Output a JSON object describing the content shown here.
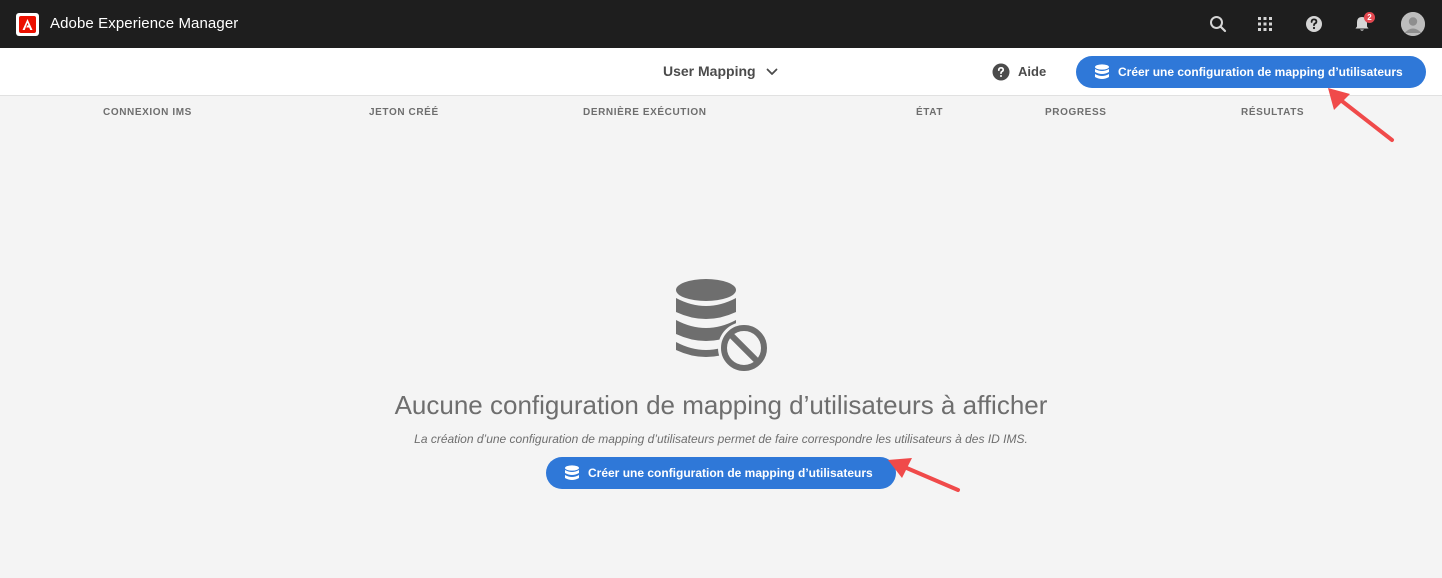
{
  "header": {
    "app_title": "Adobe Experience Manager",
    "icons": [
      "search-icon",
      "apps-grid-icon",
      "help-icon",
      "bell-icon",
      "user-avatar"
    ],
    "notification_count": "2"
  },
  "actionbar": {
    "view_label": "User Mapping",
    "help_label": "Aide",
    "create_button_label": "Créer une configuration de mapping d’utilisateurs"
  },
  "table": {
    "columns": [
      "Connexion IMS",
      "Jeton créé",
      "Dernière exécution",
      "État",
      "Progress",
      "Résultats"
    ]
  },
  "empty_state": {
    "title": "Aucune configuration de mapping d’utilisateurs à afficher",
    "description": "La création d’une configuration de mapping d’utilisateurs permet de faire correspondre les utilisateurs à des ID IMS.",
    "button_label": "Créer une configuration de mapping d’utilisateurs"
  },
  "colors": {
    "topbar": "#1e1e1e",
    "cta": "#2f78d8",
    "badge": "#e34850",
    "annotation_arrow": "#f04a4a"
  }
}
